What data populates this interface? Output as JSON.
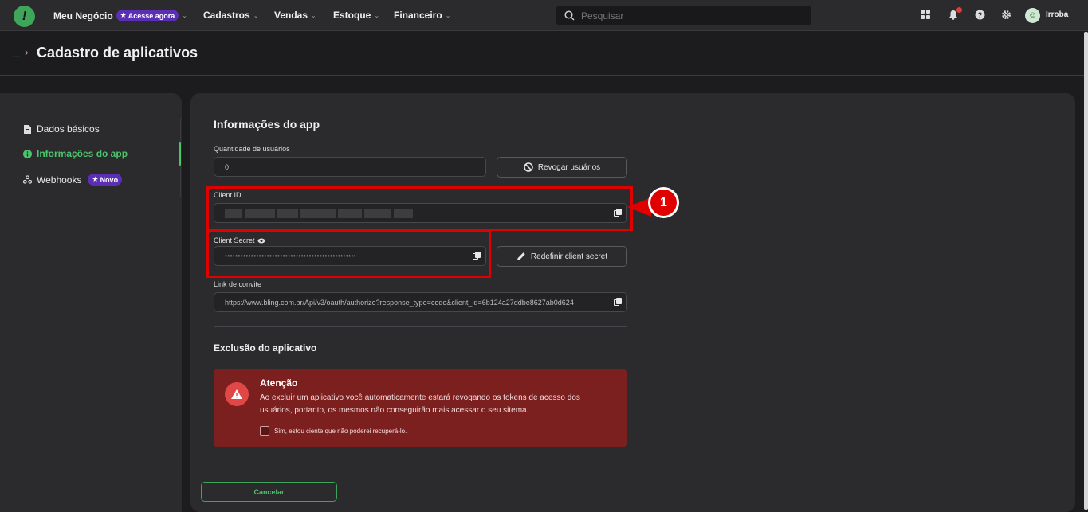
{
  "topbar": {
    "logo_glyph": "!",
    "nav": [
      {
        "label": "Meu Negócio"
      },
      {
        "label": "Cadastros"
      },
      {
        "label": "Vendas"
      },
      {
        "label": "Estoque"
      },
      {
        "label": "Financeiro"
      }
    ],
    "promo_badge": "Acesse agora",
    "search_placeholder": "Pesquisar",
    "user_name": "Irroba"
  },
  "header": {
    "breadcrumb_ellipsis": "...",
    "breadcrumb_separator": "›",
    "title": "Cadastro de aplicativos"
  },
  "sidebar": {
    "items": [
      {
        "label": "Dados básicos",
        "icon": "document-icon"
      },
      {
        "label": "Informações do app",
        "icon": "info-icon",
        "active": true
      },
      {
        "label": "Webhooks",
        "icon": "webhook-icon",
        "badge": "Novo"
      }
    ]
  },
  "app_info": {
    "title": "Informações do app",
    "users_label": "Quantidade de usuários",
    "users_value": "0",
    "revoke_button": "Revogar usuários",
    "client_id_label": "Client ID",
    "client_secret_label": "Client Secret",
    "client_secret_value": "••••••••••••••••••••••••••••••••••••••••••••••••••",
    "redefine_button": "Redefinir client secret",
    "invite_label": "Link de convite",
    "invite_value": "https://www.bling.com.br/Api/v3/oauth/authorize?response_type=code&client_id=6b124a27ddbe8627ab0d624"
  },
  "deletion": {
    "title": "Exclusão do aplicativo",
    "alert_title": "Atenção",
    "alert_text": "Ao excluir um aplicativo você automaticamente estará revogando os tokens de acesso dos usuários, portanto, os mesmos não conseguirão mais acessar o seu sitema.",
    "checkbox_label": "Sim, estou ciente que não poderei recuperá-lo."
  },
  "footer": {
    "cancel_button": "Cancelar"
  },
  "annotation": {
    "step_number": "1"
  },
  "colors": {
    "accent_green": "#3ea55a",
    "badge_purple": "#5b2fb5",
    "alert_red": "#7c1f1f",
    "annotation_red": "#e00000"
  }
}
